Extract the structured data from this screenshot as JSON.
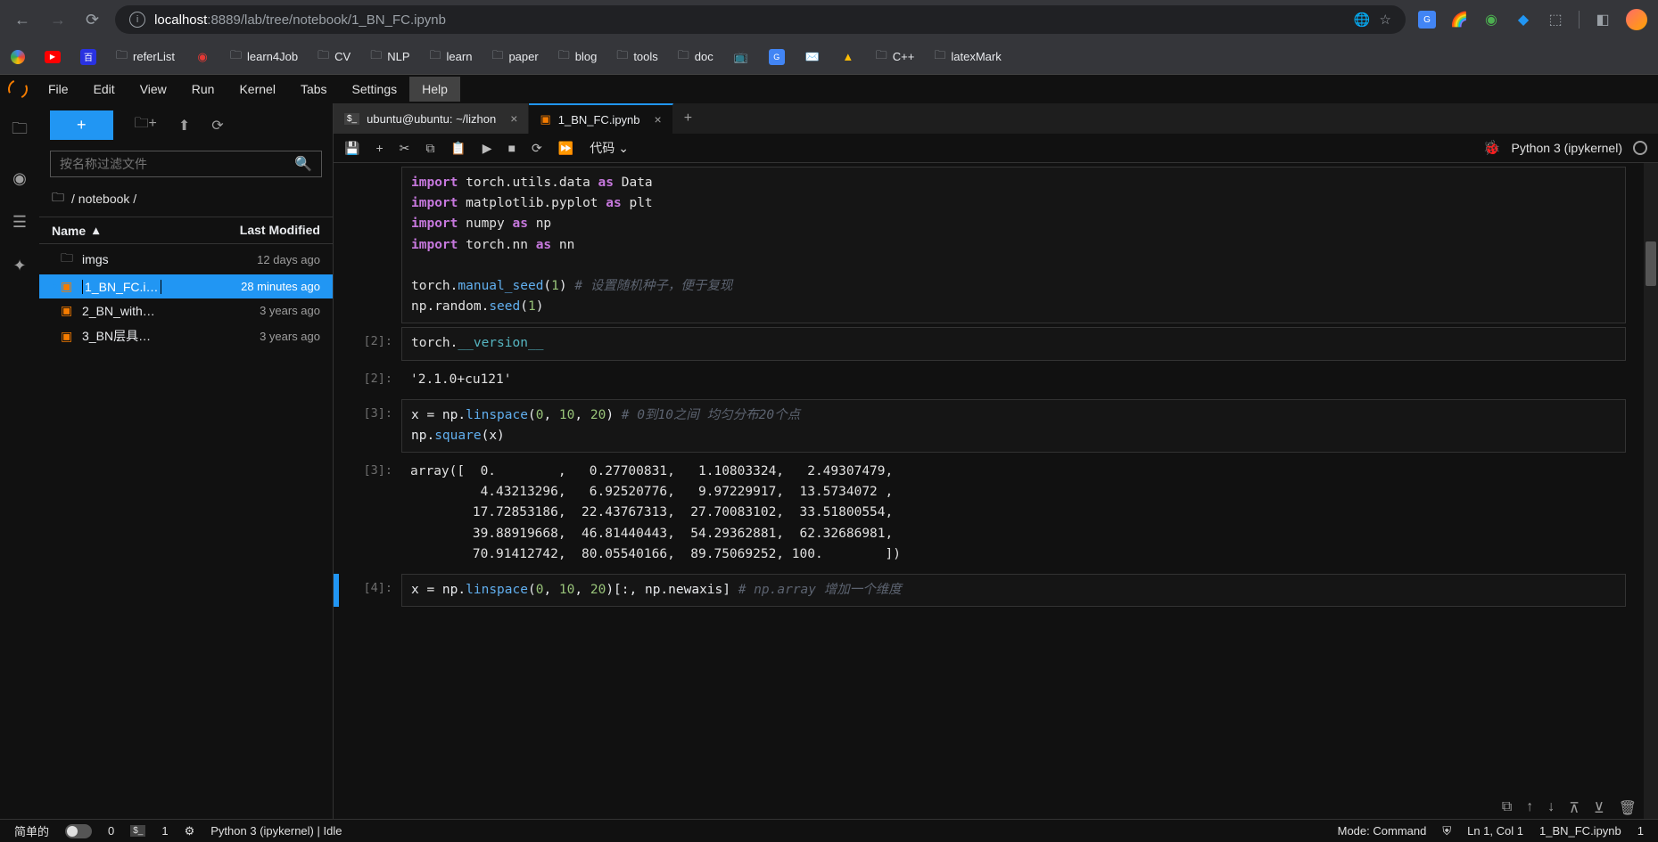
{
  "browser": {
    "url_host": "localhost",
    "url_port_path": ":8889/lab/tree/notebook/1_BN_FC.ipynb"
  },
  "bookmarks": [
    {
      "label": "",
      "icon": "google"
    },
    {
      "label": "",
      "icon": "youtube"
    },
    {
      "label": "",
      "icon": "baidu"
    },
    {
      "label": "referList",
      "icon": "folder"
    },
    {
      "label": "",
      "icon": "red-circle"
    },
    {
      "label": "learn4Job",
      "icon": "folder"
    },
    {
      "label": "CV",
      "icon": "folder"
    },
    {
      "label": "NLP",
      "icon": "folder"
    },
    {
      "label": "learn",
      "icon": "folder"
    },
    {
      "label": "paper",
      "icon": "folder"
    },
    {
      "label": "blog",
      "icon": "folder"
    },
    {
      "label": "tools",
      "icon": "folder"
    },
    {
      "label": "doc",
      "icon": "folder"
    },
    {
      "label": "",
      "icon": "bilibili"
    },
    {
      "label": "",
      "icon": "translate"
    },
    {
      "label": "",
      "icon": "gmail"
    },
    {
      "label": "",
      "icon": "drive"
    },
    {
      "label": "C++",
      "icon": "folder"
    },
    {
      "label": "latexMark",
      "icon": "folder"
    }
  ],
  "menu": {
    "items": [
      "File",
      "Edit",
      "View",
      "Run",
      "Kernel",
      "Tabs",
      "Settings",
      "Help"
    ],
    "active": 7
  },
  "filebrowser": {
    "search_placeholder": "按名称过滤文件",
    "breadcrumb_label": "/ notebook /",
    "header_name": "Name",
    "header_modified": "Last Modified",
    "items": [
      {
        "name": "imgs",
        "modified": "12 days ago",
        "type": "folder",
        "selected": false,
        "running": false
      },
      {
        "name": "1_BN_FC.i…",
        "modified": "28 minutes ago",
        "type": "notebook",
        "selected": true,
        "running": true
      },
      {
        "name": "2_BN_with…",
        "modified": "3 years ago",
        "type": "notebook",
        "selected": false,
        "running": false
      },
      {
        "name": "3_BN层具…",
        "modified": "3 years ago",
        "type": "notebook",
        "selected": false,
        "running": false
      }
    ]
  },
  "tabs": [
    {
      "label": "ubuntu@ubuntu: ~/lizhon",
      "icon": "terminal",
      "active": false
    },
    {
      "label": "1_BN_FC.ipynb",
      "icon": "notebook",
      "active": true
    }
  ],
  "nb_toolbar": {
    "cell_type": "代码",
    "kernel": "Python 3 (ipykernel)"
  },
  "cells": {
    "c1": {
      "lines": [
        {
          "kw": "import",
          "mod": " torch.utils.data ",
          "as": "as",
          "alias": " Data"
        },
        {
          "kw": "import",
          "mod": " matplotlib.pyplot ",
          "as": "as",
          "alias": " plt"
        },
        {
          "kw": "import",
          "mod": " numpy ",
          "as": "as",
          "alias": " np"
        },
        {
          "kw": "import",
          "mod": " torch.nn ",
          "as": "as",
          "alias": " nn"
        }
      ],
      "seed1_pre": "torch.",
      "seed1_func": "manual_seed",
      "seed1_args": "(",
      "seed1_num": "1",
      "seed1_close": ")",
      "seed1_comment": "  # 设置随机种子，便于复现",
      "seed2_pre": "np.random.",
      "seed2_func": "seed",
      "seed2_args": "(",
      "seed2_num": "1",
      "seed2_close": ")"
    },
    "c2": {
      "prompt_in": "[2]:",
      "code_pre": "torch.",
      "code_special": "__version__",
      "prompt_out": "[2]:",
      "output": "'2.1.0+cu121'"
    },
    "c3": {
      "prompt_in": "[3]:",
      "l1_pre": "x ",
      "l1_op": "=",
      "l1_mid": " np.",
      "l1_func": "linspace",
      "l1_open": "(",
      "l1_n1": "0",
      "l1_c1": ", ",
      "l1_n2": "10",
      "l1_c2": ", ",
      "l1_n3": "20",
      "l1_close": ")   ",
      "l1_comment": "# 0到10之间 均匀分布20个点",
      "l2_pre": "np.",
      "l2_func": "square",
      "l2_args": "(x)",
      "prompt_out": "[3]:",
      "output": "array([  0.        ,   0.27700831,   1.10803324,   2.49307479,\n         4.43213296,   6.92520776,   9.97229917,  13.5734072 ,\n        17.72853186,  22.43767313,  27.70083102,  33.51800554,\n        39.88919668,  46.81440443,  54.29362881,  62.32686981,\n        70.91412742,  80.05540166,  89.75069252, 100.        ])"
    },
    "c4": {
      "prompt_in": "[4]:",
      "pre": "x ",
      "op": "=",
      "mid": " np.",
      "func": "linspace",
      "open": "(",
      "n1": "0",
      "c1": ", ",
      "n2": "10",
      "c2": ", ",
      "n3": "20",
      "close": ")[:, np.newaxis]   ",
      "comment": "# np.array 增加一个维度"
    }
  },
  "status": {
    "left1": "简单的",
    "left2": "0",
    "left3": "1",
    "kernel": "Python 3 (ipykernel) | Idle",
    "mode": "Mode: Command",
    "pos": "Ln 1, Col 1",
    "file": "1_BN_FC.ipynb",
    "num": "1"
  }
}
